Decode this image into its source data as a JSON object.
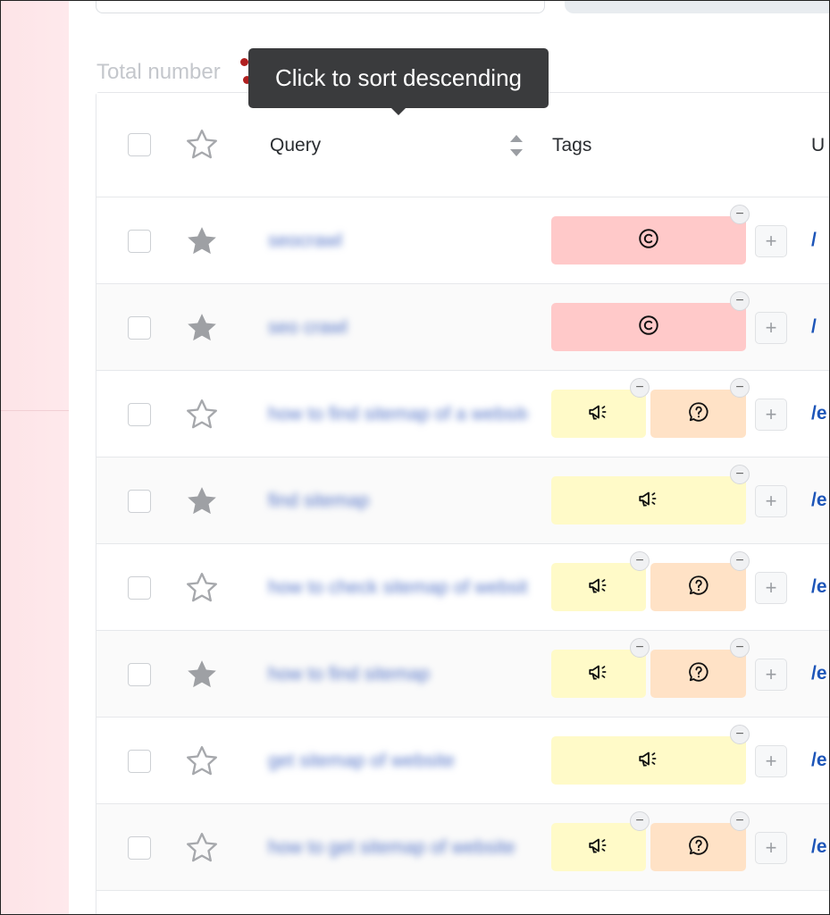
{
  "total_label": "Total number",
  "tooltip": "Click to sort descending",
  "header": {
    "query_label": "Query",
    "tags_label": "Tags",
    "url_label": "U"
  },
  "icons": {
    "star_filled_color": "#9ea0a4",
    "star_outline_color": "#a6a8ac",
    "accent_copyright": "#ffc9c9",
    "accent_promo": "#fffac8",
    "accent_question": "#ffe2c6"
  },
  "rows": [
    {
      "starred": true,
      "query": "seocrawl",
      "tags": [
        "copyright-icon"
      ],
      "url": "/"
    },
    {
      "starred": true,
      "query": "seo crawl",
      "tags": [
        "copyright-icon"
      ],
      "url": "/"
    },
    {
      "starred": false,
      "query": "how to find sitemap of a website",
      "tags": [
        "megaphone-icon",
        "question-icon"
      ],
      "url": "/e"
    },
    {
      "starred": true,
      "query": "find sitemap",
      "tags": [
        "megaphone-icon"
      ],
      "url": "/e"
    },
    {
      "starred": false,
      "query": "how to check sitemap of website",
      "tags": [
        "megaphone-icon",
        "question-icon"
      ],
      "url": "/e"
    },
    {
      "starred": true,
      "query": "how to find sitemap",
      "tags": [
        "megaphone-icon",
        "question-icon"
      ],
      "url": "/e"
    },
    {
      "starred": false,
      "query": "get sitemap of website",
      "tags": [
        "megaphone-icon"
      ],
      "url": "/e"
    },
    {
      "starred": false,
      "query": "how to get sitemap of website",
      "tags": [
        "megaphone-icon",
        "question-icon"
      ],
      "url": "/e"
    }
  ],
  "tag_remove_symbol": "−",
  "tag_add_symbol": "+"
}
